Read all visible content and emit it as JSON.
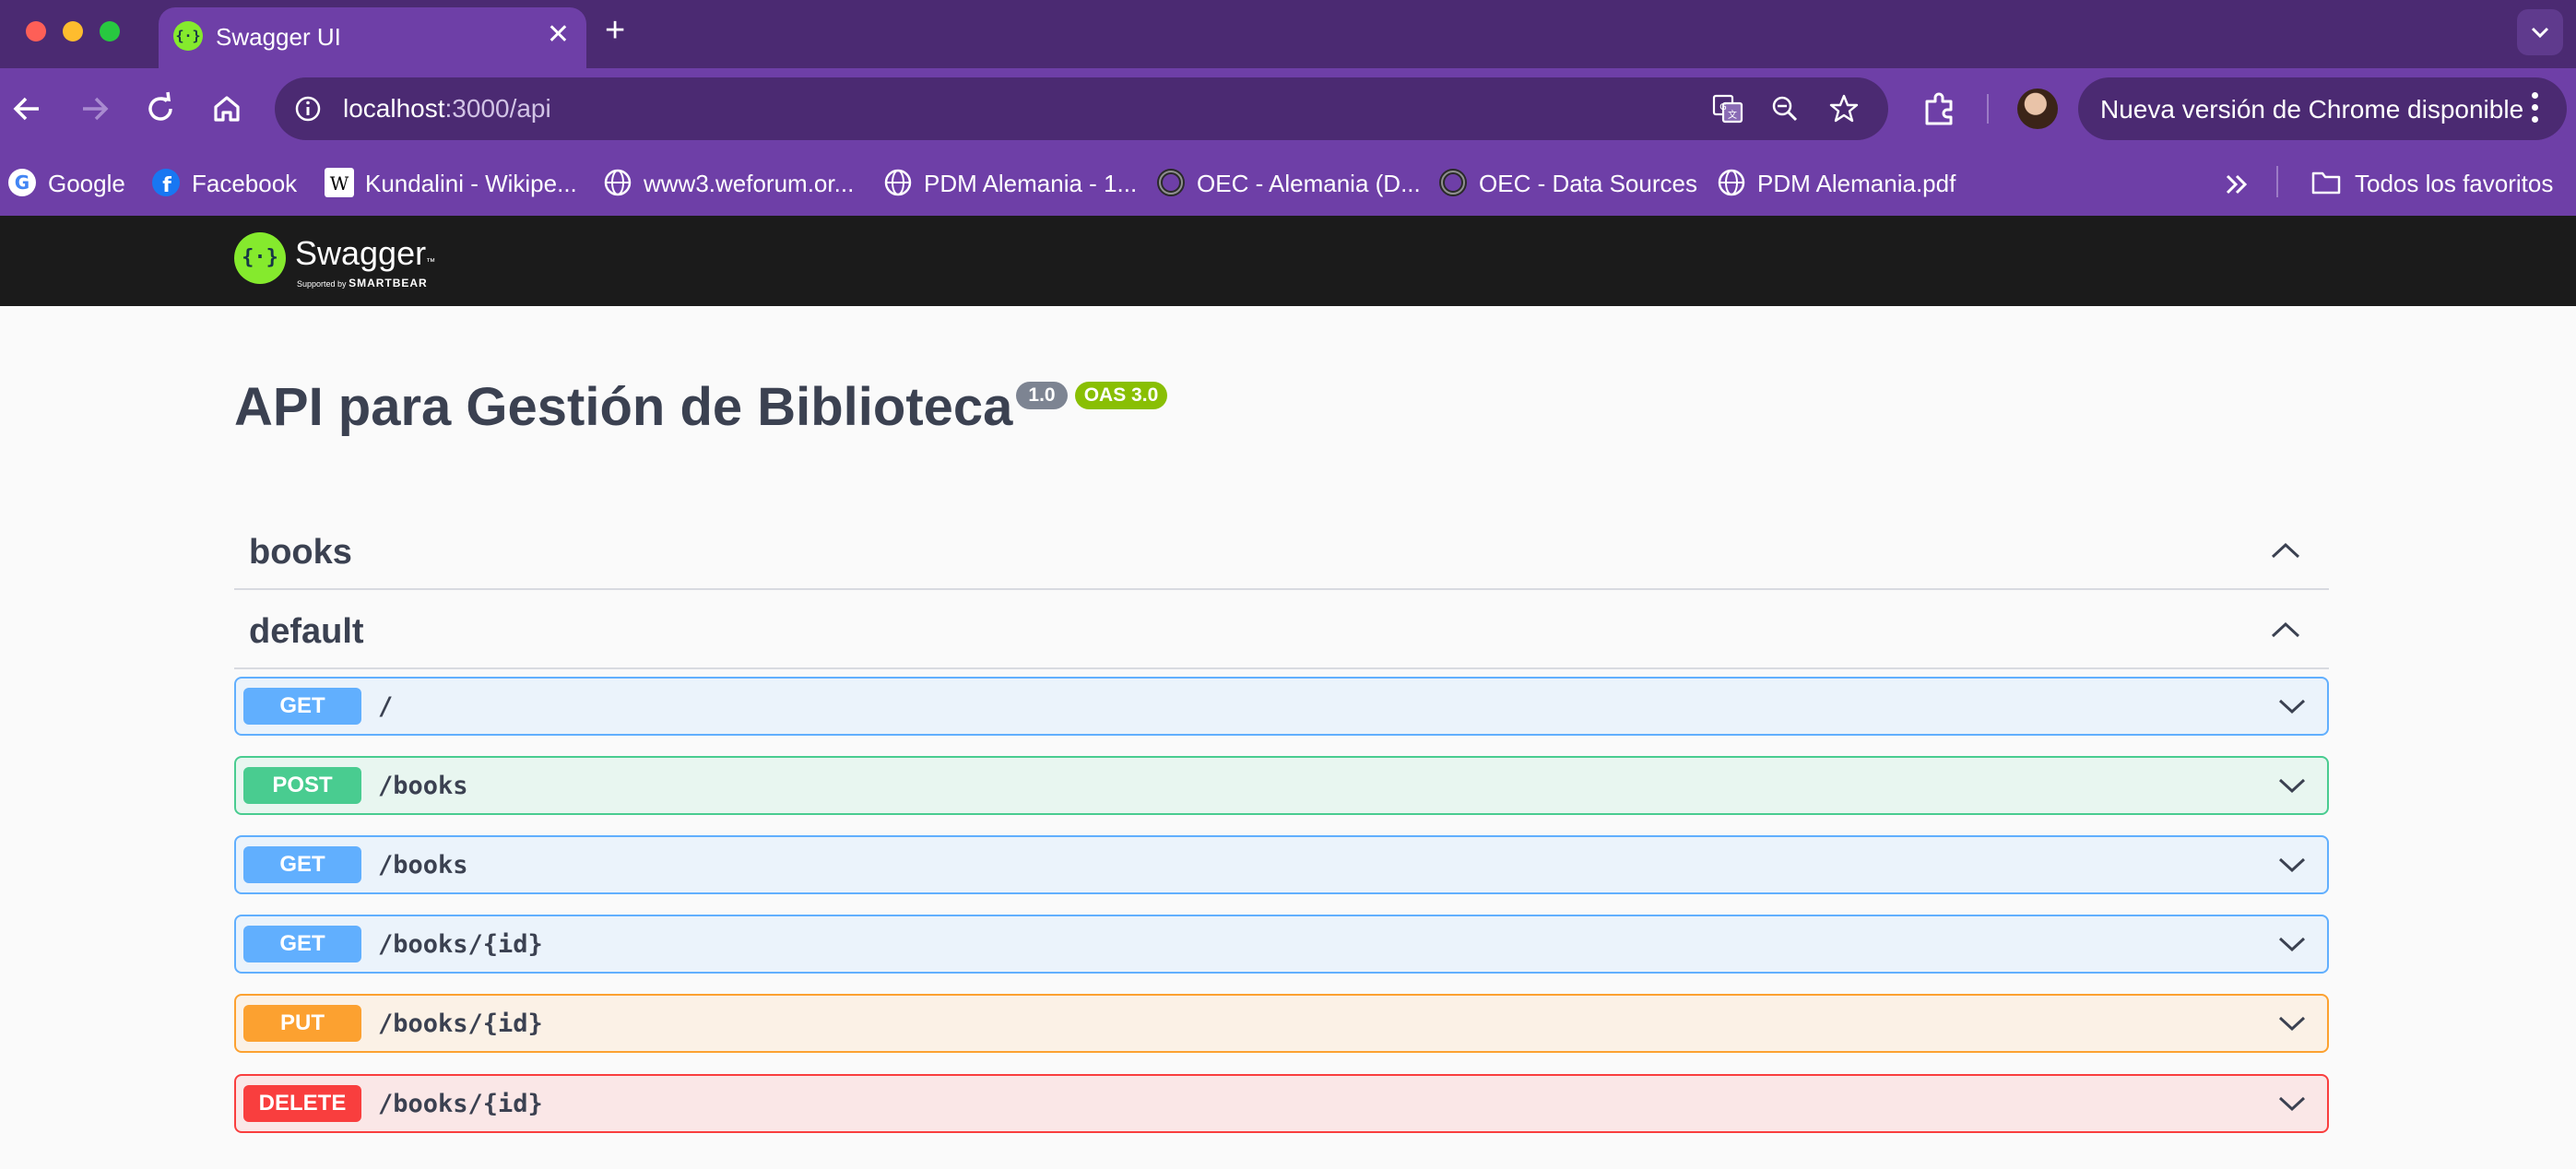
{
  "browser": {
    "tab_title": "Swagger UI",
    "url_host": "localhost",
    "url_path": ":3000/api",
    "update_label": "Nueva versión de Chrome disponible",
    "bookmarks": [
      {
        "label": "Google",
        "icon": "google-icon"
      },
      {
        "label": "Facebook",
        "icon": "facebook-icon"
      },
      {
        "label": "Kundalini - Wikipe...",
        "icon": "wikipedia-icon"
      },
      {
        "label": "www3.weforum.or...",
        "icon": "globe-icon"
      },
      {
        "label": "PDM Alemania - 1...",
        "icon": "globe-icon"
      },
      {
        "label": "OEC - Alemania (D...",
        "icon": "oec-icon"
      },
      {
        "label": "OEC - Data Sources",
        "icon": "oec-icon"
      },
      {
        "label": "PDM Alemania.pdf",
        "icon": "globe-icon"
      }
    ],
    "all_bookmarks_label": "Todos los favoritos"
  },
  "swagger": {
    "logo_text": "Swagger",
    "logo_sub_prefix": "Supported by",
    "logo_sub_brand": "SMARTBEAR"
  },
  "api": {
    "title": "API para Gestión de Biblioteca",
    "version": "1.0",
    "oas": "OAS 3.0"
  },
  "sections": [
    {
      "name": "books"
    },
    {
      "name": "default"
    }
  ],
  "operations": [
    {
      "method": "GET",
      "path": "/"
    },
    {
      "method": "POST",
      "path": "/books"
    },
    {
      "method": "GET",
      "path": "/books"
    },
    {
      "method": "GET",
      "path": "/books/{id}"
    },
    {
      "method": "PUT",
      "path": "/books/{id}"
    },
    {
      "method": "DELETE",
      "path": "/books/{id}"
    }
  ],
  "colors": {
    "tabstrip": "#4b2a72",
    "toolbar": "#6e3fa7",
    "get": "#61affe",
    "post": "#49cc90",
    "put": "#fca130",
    "delete": "#f93e3e",
    "swagger_green": "#85ea2d"
  }
}
